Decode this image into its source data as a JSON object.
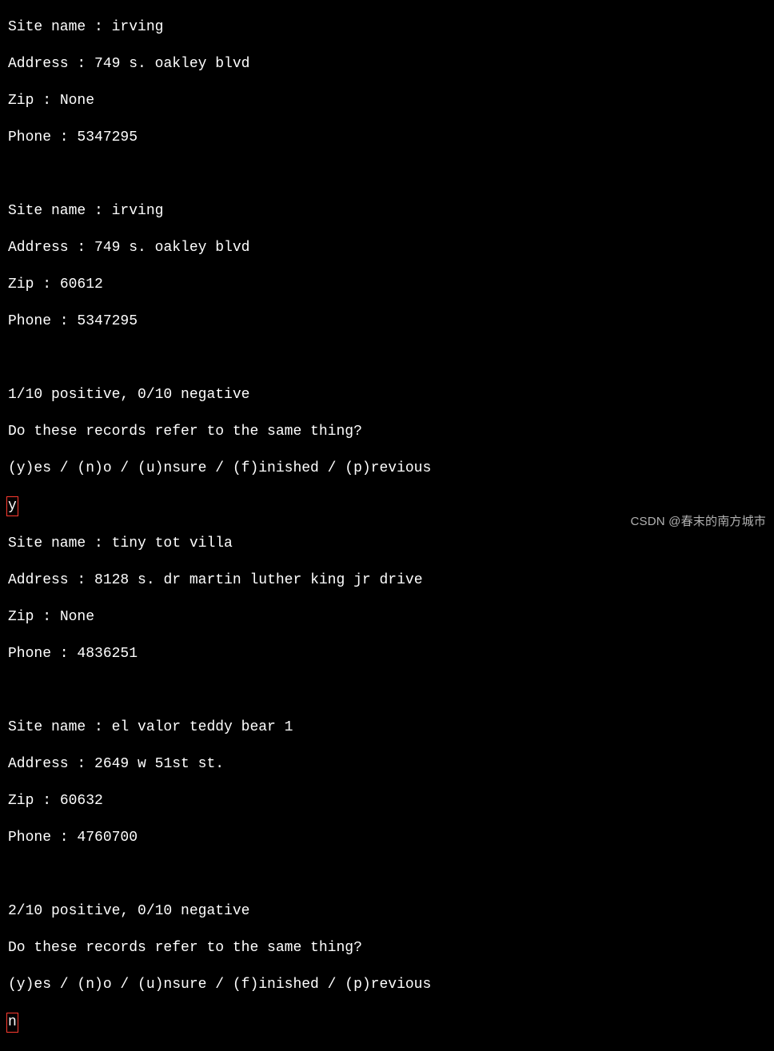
{
  "records": [
    {
      "site_name_label": "Site name : ",
      "site_name_value": "irving",
      "address_label": "Address : ",
      "address_value": "749 s. oakley blvd",
      "zip_label": "Zip : ",
      "zip_value": "None",
      "phone_label": "Phone : ",
      "phone_value": "5347295"
    },
    {
      "site_name_label": "Site name : ",
      "site_name_value": "irving",
      "address_label": "Address : ",
      "address_value": "749 s. oakley blvd",
      "zip_label": "Zip : ",
      "zip_value": "60612",
      "phone_label": "Phone : ",
      "phone_value": "5347295"
    },
    {
      "site_name_label": "Site name : ",
      "site_name_value": "tiny tot villa",
      "address_label": "Address : ",
      "address_value": "8128 s. dr martin luther king jr drive",
      "zip_label": "Zip : ",
      "zip_value": "None",
      "phone_label": "Phone : ",
      "phone_value": "4836251"
    },
    {
      "site_name_label": "Site name : ",
      "site_name_value": "el valor teddy bear 1",
      "address_label": "Address : ",
      "address_value": "2649 w 51st st.",
      "zip_label": "Zip : ",
      "zip_value": "60632",
      "phone_label": "Phone : ",
      "phone_value": "4760700"
    }
  ],
  "prompts": [
    {
      "status": "1/10 positive, 0/10 negative",
      "question": "Do these records refer to the same thing?",
      "options": "(y)es / (n)o / (u)nsure / (f)inished / (p)revious",
      "response": "y"
    },
    {
      "status": "2/10 positive, 0/10 negative",
      "question": "Do these records refer to the same thing?",
      "options": "(y)es / (n)o / (u)nsure / (f)inished / (p)revious",
      "response": "n"
    }
  ],
  "watermark": "CSDN @春末的南方城市"
}
